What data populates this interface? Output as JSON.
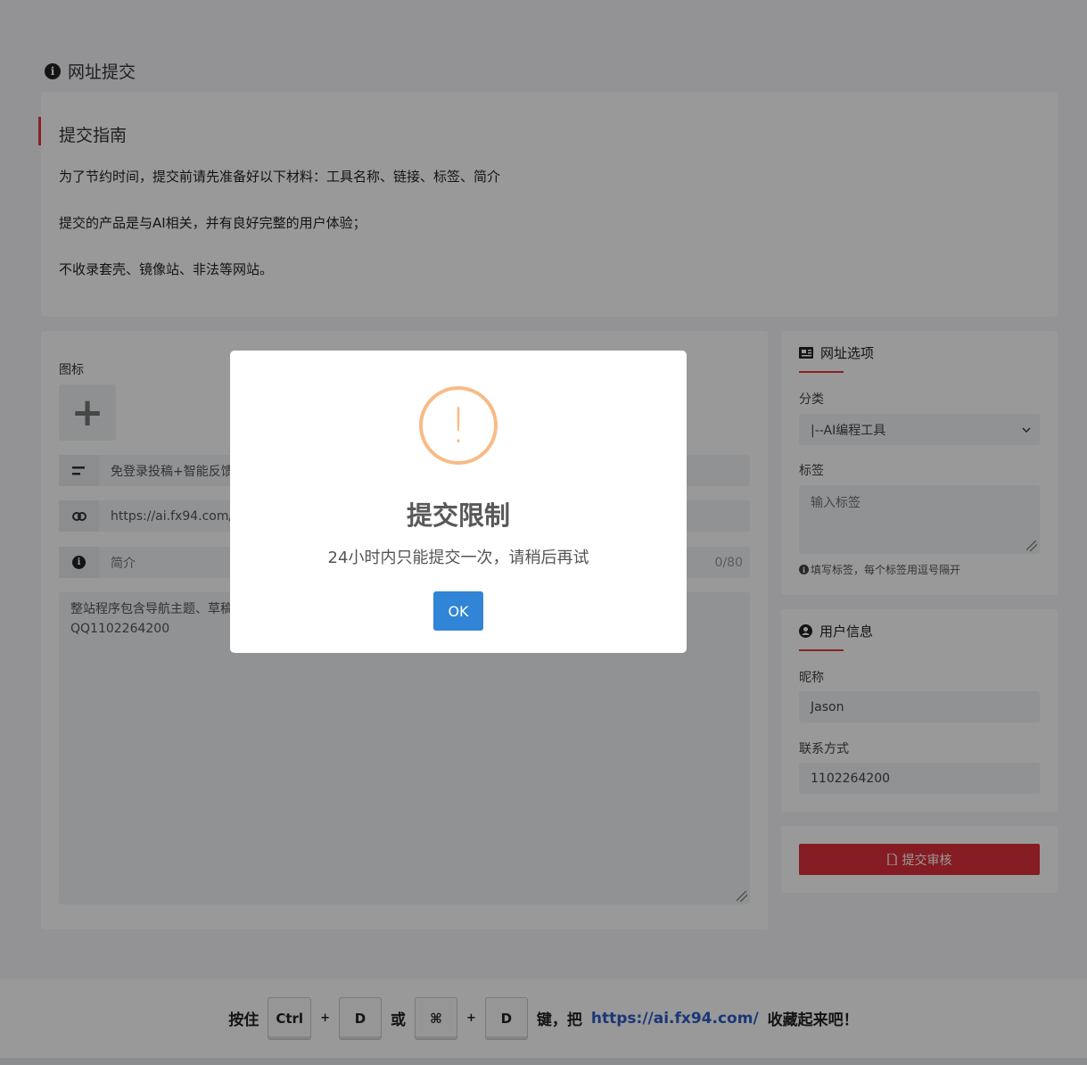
{
  "page": {
    "title": "网址提交",
    "title_icon": "info-circle-icon"
  },
  "guide": {
    "title": "提交指南",
    "lines": [
      "为了节约时间，提交前请先准备好以下材料：工具名称、链接、标签、简介",
      "提交的产品是与AI相关，并有良好完整的用户体验；",
      "不收录套壳、镜像站、非法等网站。"
    ]
  },
  "form": {
    "icon_label": "图标",
    "icon_upload_glyph": "+",
    "name_value": "免登录投稿+智能反馈",
    "url_value": "https://ai.fx94.com/",
    "intro_placeholder": "简介",
    "intro_counter": "0/80",
    "description_value": "整站程序包含导航主题、草稿\nQQ1102264200"
  },
  "options": {
    "title": "网址选项",
    "category_label": "分类",
    "category_value": "|--AI编程工具",
    "tags_label": "标签",
    "tags_placeholder": "输入标签",
    "tags_hint": "填写标签，每个标签用逗号隔开"
  },
  "user": {
    "title": "用户信息",
    "nickname_label": "昵称",
    "nickname_value": "Jason",
    "contact_label": "联系方式",
    "contact_value": "1102264200"
  },
  "submit": {
    "label": "提交审核"
  },
  "footer": {
    "press": "按住",
    "key_ctrl": "Ctrl",
    "key_d": "D",
    "or": "或",
    "key_cmd": "⌘",
    "key_d2": "D",
    "key_then": "键，把",
    "link": "https://ai.fx94.com/",
    "bookmark": "收藏起来吧！"
  },
  "modal": {
    "title": "提交限制",
    "message": "24小时内只能提交一次，请稍后再试",
    "ok_label": "OK",
    "icon": "warning-icon",
    "icon_color": "#f8bb86",
    "button_color": "#3085d6"
  },
  "colors": {
    "accent": "#e4373f",
    "submit_bg": "#e02f3b",
    "link": "#2c5cc5"
  }
}
